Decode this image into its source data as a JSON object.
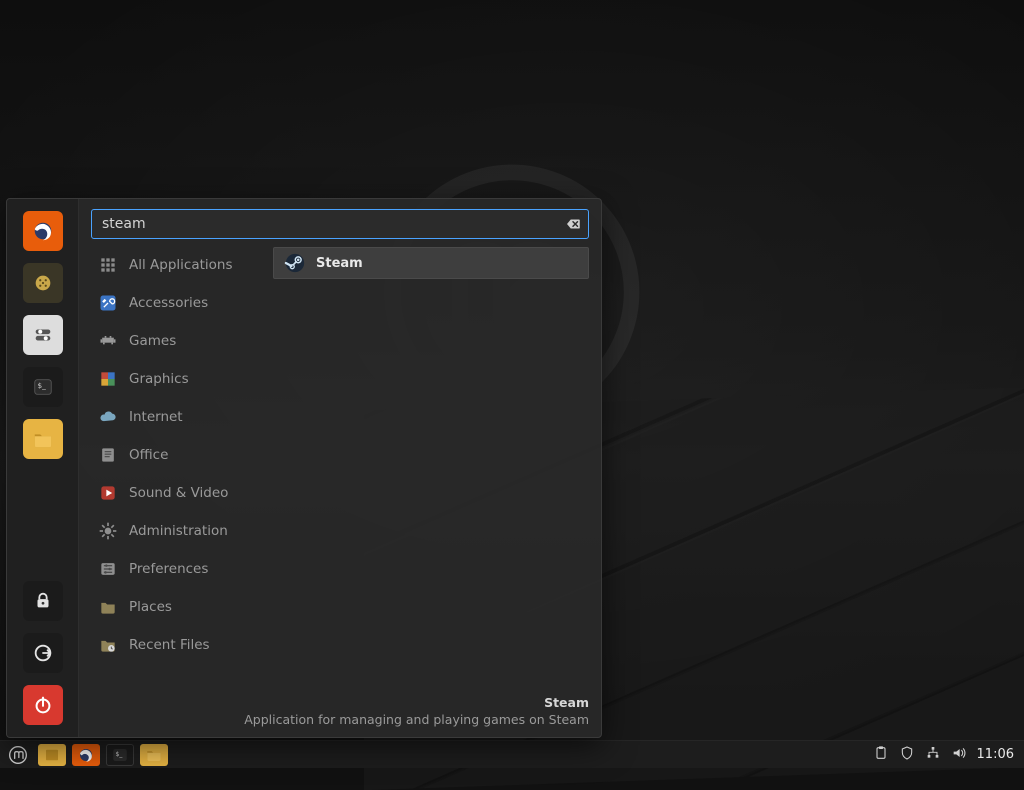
{
  "search": {
    "value": "steam",
    "clear_icon": "backspace"
  },
  "favorites": [
    {
      "name": "firefox",
      "icon": "firefox"
    },
    {
      "name": "software-manager",
      "icon": "grid"
    },
    {
      "name": "system-settings",
      "icon": "toggles"
    },
    {
      "name": "terminal",
      "icon": "terminal"
    },
    {
      "name": "files",
      "icon": "folder"
    }
  ],
  "session": [
    {
      "name": "lock-screen",
      "icon": "lock"
    },
    {
      "name": "logout",
      "icon": "logout"
    },
    {
      "name": "quit",
      "icon": "power"
    }
  ],
  "categories": [
    {
      "label": "All Applications",
      "icon": "grid9"
    },
    {
      "label": "Accessories",
      "icon": "tools-blue"
    },
    {
      "label": "Games",
      "icon": "invader"
    },
    {
      "label": "Graphics",
      "icon": "mosaic"
    },
    {
      "label": "Internet",
      "icon": "cloud"
    },
    {
      "label": "Office",
      "icon": "doc"
    },
    {
      "label": "Sound & Video",
      "icon": "play-red"
    },
    {
      "label": "Administration",
      "icon": "gear"
    },
    {
      "label": "Preferences",
      "icon": "sliders"
    },
    {
      "label": "Places",
      "icon": "folder-dim"
    },
    {
      "label": "Recent Files",
      "icon": "folder-clock"
    }
  ],
  "results": [
    {
      "label": "Steam",
      "icon": "steam"
    }
  ],
  "footer": {
    "title": "Steam",
    "description": "Application for managing and playing games on Steam"
  },
  "taskbar": [
    {
      "name": "show-desktop",
      "icon": "desktop",
      "accent": "#e7b443"
    },
    {
      "name": "firefox",
      "icon": "firefox",
      "accent": "#e85d0b"
    },
    {
      "name": "terminal",
      "icon": "terminal",
      "accent": "#1b1b1b"
    },
    {
      "name": "files",
      "icon": "folder",
      "accent": "#e7b443"
    }
  ],
  "tray": [
    {
      "name": "updates",
      "icon": "clipboard"
    },
    {
      "name": "firewall",
      "icon": "shield"
    },
    {
      "name": "network",
      "icon": "network"
    },
    {
      "name": "sound",
      "icon": "sound"
    }
  ],
  "clock": "11:06",
  "colors": {
    "accentOrange": "#e85d0b",
    "accentFolder": "#e7b443",
    "accentRed": "#d8392f",
    "searchFocus": "#4aa3ff"
  }
}
